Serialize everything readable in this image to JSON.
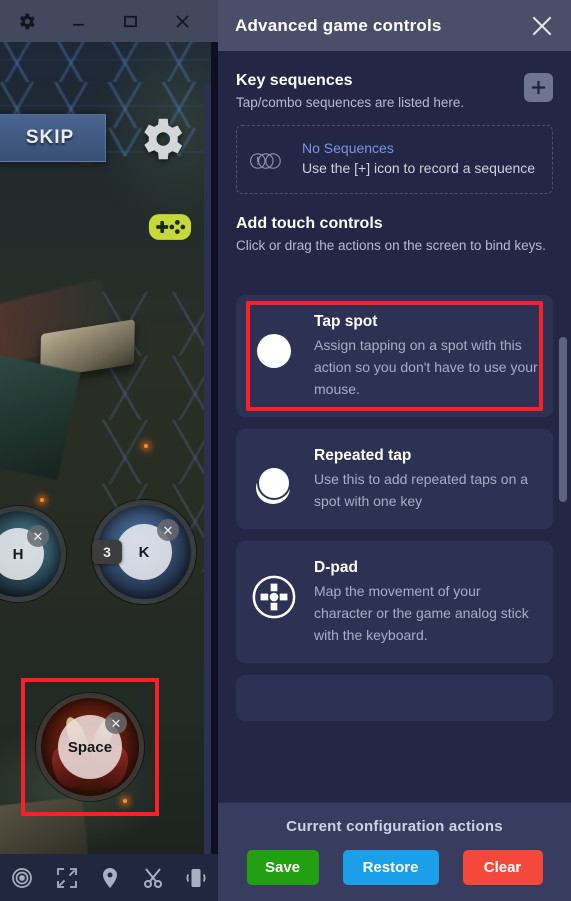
{
  "emulator": {
    "titlebar": {
      "buttons": [
        {
          "name": "settings-gear",
          "label": "⚙"
        },
        {
          "name": "minimize",
          "label": "—"
        },
        {
          "name": "maximize",
          "label": "□"
        },
        {
          "name": "close",
          "label": "✕"
        }
      ]
    },
    "game": {
      "skip_label": "SKIP",
      "gear_icon": "gear-icon",
      "gamepad_icon": "gamepad-icon"
    },
    "touch_controls": [
      {
        "key": "H",
        "badge": "",
        "highlighted": false
      },
      {
        "key": "K",
        "badge": "3",
        "highlighted": false
      },
      {
        "key": "Space",
        "badge": "",
        "highlighted": true
      }
    ],
    "close_glyph": "✕",
    "bottom_toolbar": [
      {
        "name": "eye-icon"
      },
      {
        "name": "fullscreen-icon"
      },
      {
        "name": "location-pin-icon"
      },
      {
        "name": "scissors-icon"
      },
      {
        "name": "shake-phone-icon"
      }
    ]
  },
  "panel": {
    "title": "Advanced game controls",
    "close_glyph": "✕",
    "key_sequences": {
      "title": "Key sequences",
      "subtitle": "Tap/combo sequences are listed here.",
      "add_glyph": "+",
      "empty": {
        "title": "No Sequences",
        "description": "Use the [+] icon to record a sequence"
      }
    },
    "add_touch_controls": {
      "title": "Add touch controls",
      "subtitle": "Click or drag the actions on the screen to bind keys."
    },
    "controls": [
      {
        "title": "Tap spot",
        "description": "Assign tapping on a spot with this action so you don't have to use your mouse.",
        "icon": "circle-icon",
        "highlighted": true
      },
      {
        "title": "Repeated tap",
        "description": "Use this to add repeated taps on a spot with one key",
        "icon": "stacked-circles-icon",
        "highlighted": false
      },
      {
        "title": "D-pad",
        "description": "Map the movement of your character or the game analog stick with the keyboard.",
        "icon": "dpad-icon",
        "highlighted": false
      }
    ],
    "footer": {
      "title": "Current configuration actions",
      "buttons": [
        {
          "label": "Save",
          "color": "#22a012"
        },
        {
          "label": "Restore",
          "color": "#1a9fe8"
        },
        {
          "label": "Clear",
          "color": "#f4483c"
        }
      ]
    }
  },
  "colors": {
    "panel_bg": "#232745",
    "panel_header": "#4a4e68",
    "card_bg": "#2d3255",
    "footer_bg": "#383d60",
    "highlight_red": "#fd1f28",
    "link_blue": "#7b97e0"
  }
}
